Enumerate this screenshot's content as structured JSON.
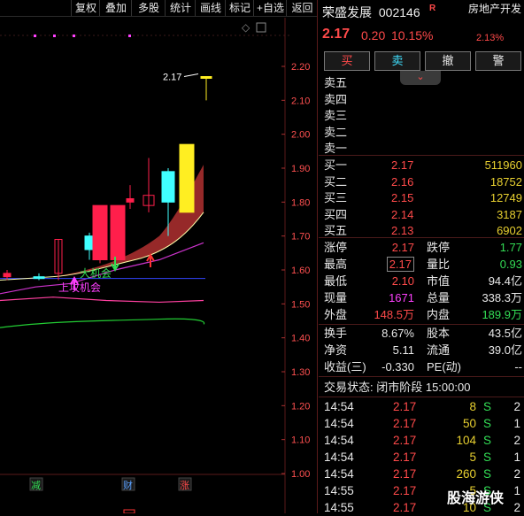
{
  "toolbar": {
    "buttons": [
      "复权",
      "叠加",
      "多股",
      "统计",
      "画线",
      "标记",
      "+自选",
      "返回"
    ]
  },
  "chart": {
    "price_axis": [
      "2.20",
      "2.10",
      "2.00",
      "1.90",
      "1.80",
      "1.70",
      "1.60",
      "1.50",
      "1.40",
      "1.30",
      "1.20",
      "1.10",
      "1.00"
    ],
    "last_price_label": "2.17",
    "signal_sell": "大机会",
    "signal_buy": "上攻机会",
    "bottom_tags": [
      {
        "text": "减",
        "color": "#33dd55"
      },
      {
        "text": "财",
        "color": "#5aa0ff"
      },
      {
        "text": "涨",
        "color": "#ff4a4a"
      }
    ],
    "colors": {
      "up": "#ff1f4b",
      "down": "#40ffff",
      "yellow": "#ffee22",
      "band": "#b03030"
    }
  },
  "chart_data": {
    "type": "candlestick",
    "ylim": [
      0.95,
      2.26
    ],
    "candles": [
      {
        "o": 1.58,
        "c": 1.59,
        "h": 1.6,
        "l": 1.57,
        "color": "up"
      },
      {
        "o": 1.58,
        "c": 1.58,
        "h": 1.59,
        "l": 1.57,
        "color": "down"
      },
      {
        "o": 1.59,
        "c": 1.69,
        "h": 1.69,
        "l": 1.57,
        "color": "up"
      },
      {
        "o": 1.66,
        "c": 1.7,
        "h": 1.71,
        "l": 1.63,
        "color": "down"
      },
      {
        "o": 1.63,
        "c": 1.79,
        "h": 1.79,
        "l": 1.62,
        "color": "up"
      },
      {
        "o": 1.79,
        "c": 1.63,
        "h": 1.79,
        "l": 1.63,
        "color": "up"
      },
      {
        "o": 1.8,
        "c": 1.81,
        "h": 1.85,
        "l": 1.78,
        "color": "up"
      },
      {
        "o": 1.79,
        "c": 1.82,
        "h": 1.93,
        "l": 1.77,
        "color": "up"
      },
      {
        "o": 1.8,
        "c": 1.89,
        "h": 1.9,
        "l": 1.7,
        "color": "down"
      },
      {
        "o": 1.77,
        "c": 1.97,
        "h": 1.97,
        "l": 1.77,
        "color": "yellow"
      },
      {
        "o": 2.17,
        "c": 2.17,
        "h": 2.17,
        "l": 2.1,
        "color": "yellow"
      }
    ]
  },
  "stock": {
    "name": "荣盛发展",
    "code": "002146",
    "r_mark": "R",
    "price": "2.17",
    "change": "0.20",
    "change_pct": "10.15%",
    "sector": "房地产开发",
    "sector_change": "2.13%"
  },
  "trade_buttons": [
    "买",
    "卖",
    "撤",
    "警"
  ],
  "order_book": {
    "asks": [
      {
        "label": "卖五",
        "price": "",
        "vol": ""
      },
      {
        "label": "卖四",
        "price": "",
        "vol": ""
      },
      {
        "label": "卖三",
        "price": "",
        "vol": ""
      },
      {
        "label": "卖二",
        "price": "",
        "vol": ""
      },
      {
        "label": "卖一",
        "price": "",
        "vol": ""
      }
    ],
    "bids": [
      {
        "label": "买一",
        "price": "2.17",
        "vol": "511960"
      },
      {
        "label": "买二",
        "price": "2.16",
        "vol": "18752"
      },
      {
        "label": "买三",
        "price": "2.15",
        "vol": "12749"
      },
      {
        "label": "买四",
        "price": "2.14",
        "vol": "3187"
      },
      {
        "label": "买五",
        "price": "2.13",
        "vol": "6902"
      }
    ]
  },
  "quote_stats": [
    {
      "l1": "涨停",
      "v1": "2.17",
      "c1": "red",
      "l2": "跌停",
      "v2": "1.77",
      "c2": "green"
    },
    {
      "l1": "最高",
      "v1": "2.17",
      "c1": "red",
      "l2": "量比",
      "v2": "0.93",
      "c2": "green"
    },
    {
      "l1": "最低",
      "v1": "2.10",
      "c1": "red",
      "l2": "市值",
      "v2": "94.4亿",
      "c2": "white"
    },
    {
      "l1": "现量",
      "v1": "1671",
      "c1": "mag",
      "l2": "总量",
      "v2": "338.3万",
      "c2": "white"
    },
    {
      "l1": "外盘",
      "v1": "148.5万",
      "c1": "red",
      "l2": "内盘",
      "v2": "189.9万",
      "c2": "green"
    }
  ],
  "fund_stats": [
    {
      "l1": "换手",
      "v1": "8.67%",
      "l2": "股本",
      "v2": "43.5亿"
    },
    {
      "l1": "净资",
      "v1": "5.11",
      "l2": "流通",
      "v2": "39.0亿"
    },
    {
      "l1": "收益(三)",
      "v1": "-0.330",
      "l2": "PE(动)",
      "v2": "--"
    }
  ],
  "trade_status": "交易状态: 闭市阶段 15:00:00",
  "ticks": [
    {
      "time": "14:54",
      "price": "2.17",
      "vol": "8",
      "side": "S",
      "n": "2"
    },
    {
      "time": "14:54",
      "price": "2.17",
      "vol": "50",
      "side": "S",
      "n": "1"
    },
    {
      "time": "14:54",
      "price": "2.17",
      "vol": "104",
      "side": "S",
      "n": "2"
    },
    {
      "time": "14:54",
      "price": "2.17",
      "vol": "5",
      "side": "S",
      "n": "1"
    },
    {
      "time": "14:54",
      "price": "2.17",
      "vol": "260",
      "side": "S",
      "n": "2"
    },
    {
      "time": "14:55",
      "price": "2.17",
      "vol": "5",
      "side": "S",
      "n": "1"
    },
    {
      "time": "14:55",
      "price": "2.17",
      "vol": "10",
      "side": "S",
      "n": "2"
    }
  ],
  "watermark": "股海游侠"
}
